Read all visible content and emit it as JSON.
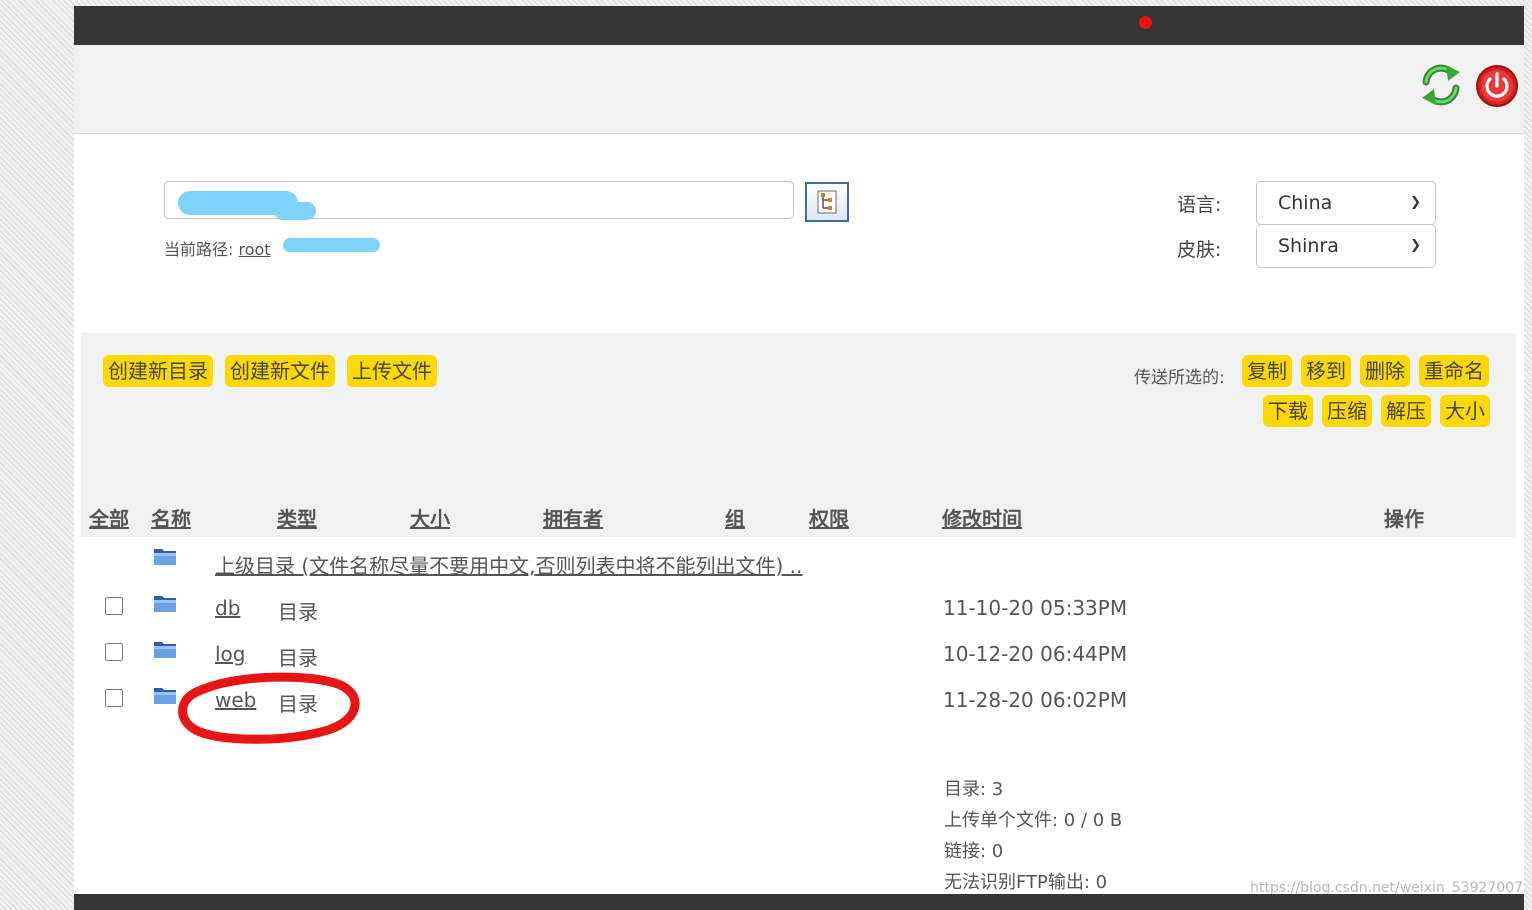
{
  "toolbar": {
    "refresh_icon": "refresh-icon",
    "power_icon": "power-icon"
  },
  "path_bar": {
    "current_path_label": "当前路径:",
    "root_link": "root"
  },
  "settings": {
    "language_label": "语言:",
    "language_value": "China",
    "skin_label": "皮肤:",
    "skin_value": "Shinra"
  },
  "actions": {
    "create_dir": "创建新目录",
    "create_file": "创建新文件",
    "upload": "上传文件",
    "send_selected_label": "传送所选的:",
    "copy": "复制",
    "move": "移到",
    "delete": "删除",
    "rename": "重命名",
    "download": "下载",
    "compress": "压缩",
    "extract": "解压",
    "size": "大小"
  },
  "table": {
    "headers": {
      "all": "全部",
      "name": "名称",
      "type": "类型",
      "size": "大小",
      "owner": "拥有者",
      "group": "组",
      "permissions": "权限",
      "modified": "修改时间",
      "operations": "操作"
    },
    "parent_dir": "上级目录 (文件名称尽量不要用中文,否则列表中将不能列出文件) ..",
    "rows": [
      {
        "name": "db",
        "type": "目录",
        "modified": "11-10-20 05:33PM"
      },
      {
        "name": "log",
        "type": "目录",
        "modified": "10-12-20 06:44PM"
      },
      {
        "name": "web",
        "type": "目录",
        "modified": "11-28-20 06:02PM"
      }
    ]
  },
  "stats": {
    "dirs": "目录: 3",
    "upload": "上传单个文件: 0 / 0 B",
    "links": "链接: 0",
    "unrecognized": "无法识别FTP输出: 0"
  },
  "watermark": "https://blog.csdn.net/weixin_53927007",
  "colors": {
    "action_button": "#fdd700",
    "topbar": "#363636",
    "annotation": "#e81515"
  }
}
